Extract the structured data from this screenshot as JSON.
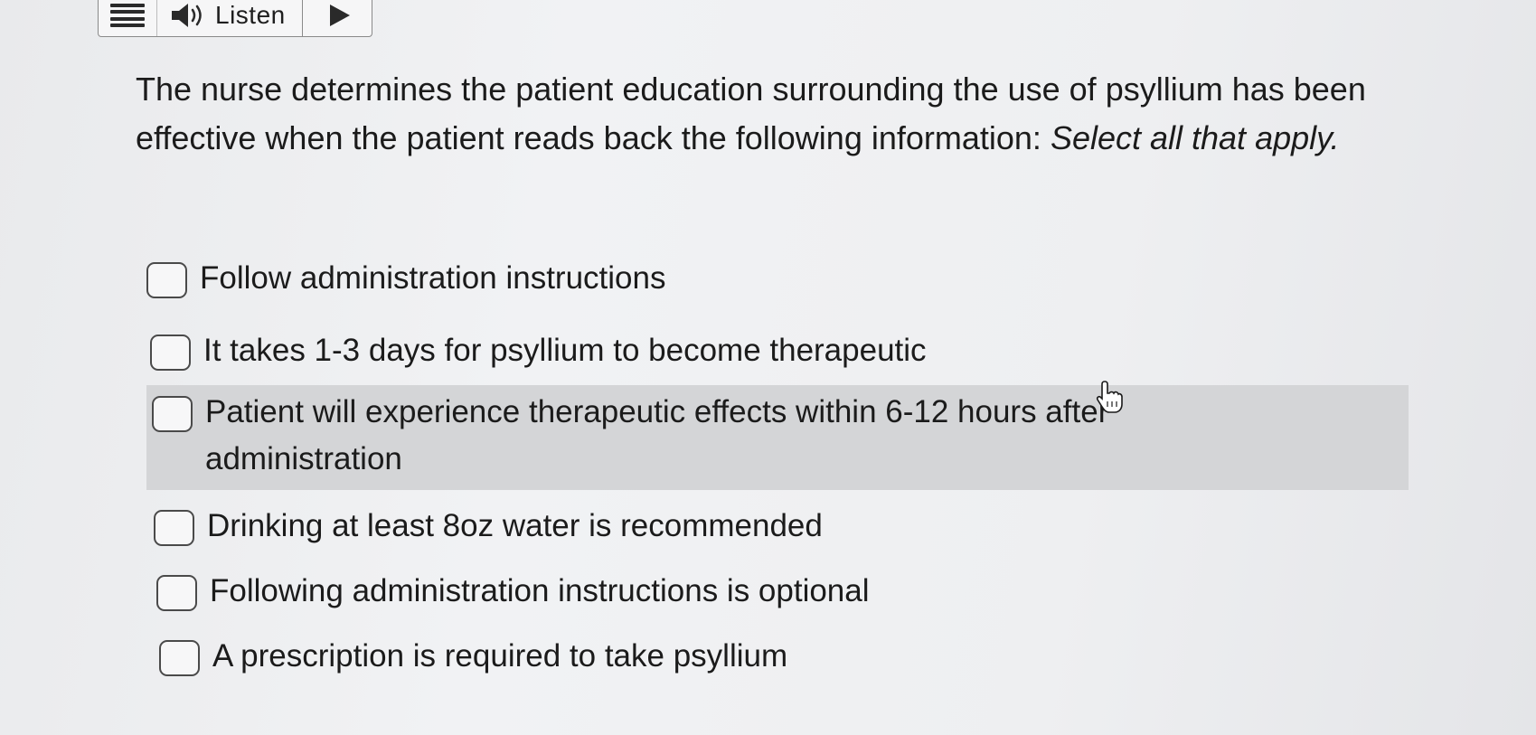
{
  "toolbar": {
    "menu_icon": "menu-icon",
    "speaker_icon": "speaker-icon",
    "listen_label": "Listen",
    "play_icon": "play-icon"
  },
  "question": {
    "text": "The nurse determines the patient education surrounding the use of psyllium has been effective when the patient reads back the following information: ",
    "instruction": "Select all that apply."
  },
  "options": [
    {
      "label": "Follow administration instructions",
      "checked": false
    },
    {
      "label": "It takes 1-3 days for psyllium to become therapeutic",
      "checked": false
    },
    {
      "label": "Patient will experience therapeutic effects within 6-12 hours after administration",
      "checked": false,
      "hovered": true
    },
    {
      "label": "Drinking at least 8oz water is recommended",
      "checked": false
    },
    {
      "label": "Following administration instructions is optional",
      "checked": false
    },
    {
      "label": "A prescription is required to take psyllium",
      "checked": false
    }
  ],
  "colors": {
    "highlight": "#d4d5d7",
    "text": "#1b1b1b"
  }
}
